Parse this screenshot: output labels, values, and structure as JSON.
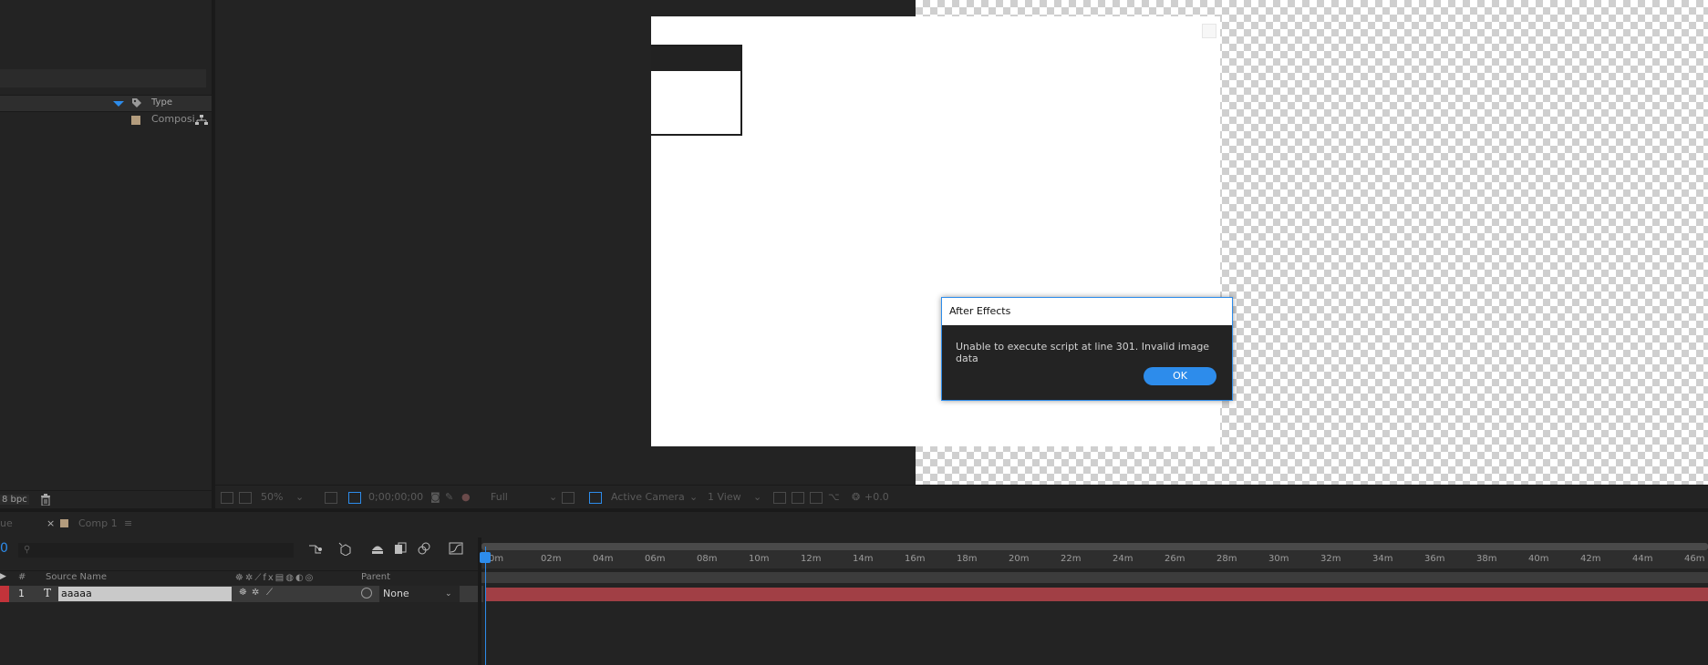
{
  "project": {
    "type_column_label": "Type",
    "item_type": "Composi",
    "bit_depth": "8 bpc"
  },
  "viewer": {
    "zoom": "50%",
    "timecode": "0;00;00;00",
    "resolution": "Full",
    "camera": "Active Camera",
    "views": "1 View",
    "exposure": "+0.0"
  },
  "timeline": {
    "tab_left": "ue",
    "tab_close": "×",
    "comp_tab": "Comp 1",
    "comp_tab_menu": "≡",
    "timecode": "0",
    "columns": {
      "number": "#",
      "source_name": "Source Name",
      "parent": "Parent"
    },
    "layers": [
      {
        "number": "1",
        "type_glyph": "T",
        "name": "aaaaa",
        "parent": "None",
        "label_color": "#c2333a"
      }
    ],
    "ruler_ticks": [
      "0m",
      "02m",
      "04m",
      "06m",
      "08m",
      "10m",
      "12m",
      "14m",
      "16m",
      "18m",
      "20m",
      "22m",
      "24m",
      "26m",
      "28m",
      "30m",
      "32m",
      "34m",
      "36m",
      "38m",
      "40m",
      "42m",
      "44m",
      "46m"
    ]
  },
  "dialog": {
    "title": "After Effects",
    "message": "Unable to  execute script at line 301. Invalid image data",
    "ok_label": "OK"
  },
  "colors": {
    "accent": "#2d8ceb",
    "panel_bg": "#232323",
    "layer_bar": "#a13f45",
    "comp_swatch": "#b39c7d"
  }
}
